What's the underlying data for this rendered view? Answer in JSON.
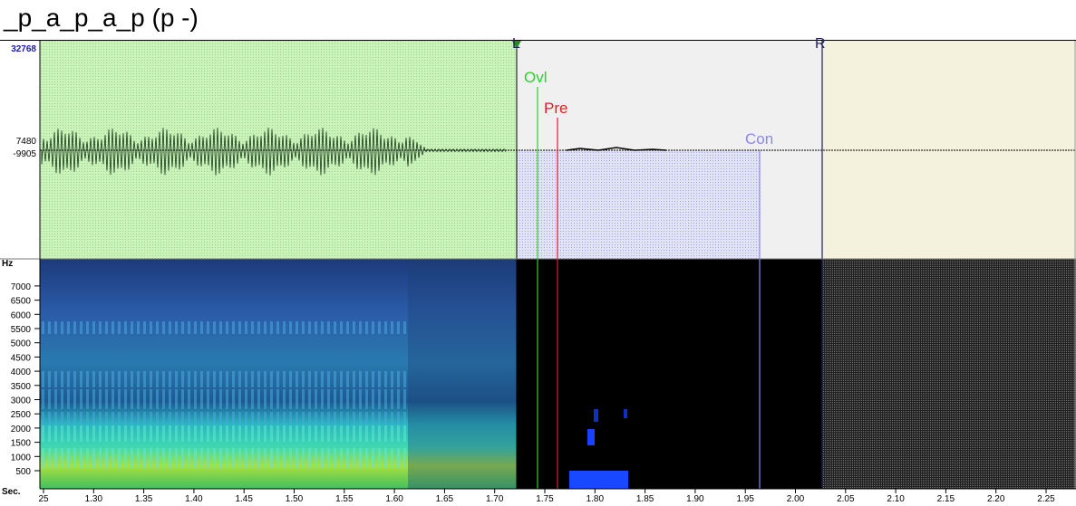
{
  "title": "_p_a_p_a_p (p -)",
  "waveform": {
    "y_max_label": "32768",
    "y_mid_label": "7480",
    "y_mid2_label": "-9905"
  },
  "spectrogram": {
    "unit_label": "Hz",
    "freq_ticks": [
      "7000",
      "6500",
      "6000",
      "5500",
      "5000",
      "4500",
      "4000",
      "3500",
      "3000",
      "2500",
      "2000",
      "1500",
      "1000",
      "500"
    ]
  },
  "time_axis": {
    "unit_label": "Sec.",
    "ticks": [
      "25",
      "1.30",
      "1.35",
      "1.40",
      "1.45",
      "1.50",
      "1.55",
      "1.60",
      "1.65",
      "1.70",
      "1.75",
      "1.80",
      "1.85",
      "1.90",
      "1.95",
      "2.00",
      "2.05",
      "2.10",
      "2.15",
      "2.20",
      "2.25"
    ]
  },
  "markers": {
    "left": {
      "label": "L",
      "color": "#1a6e1a"
    },
    "right": {
      "label": "R",
      "color": "#20205a"
    },
    "ovl": {
      "label": "Ovl",
      "color": "#33cc33"
    },
    "pre": {
      "label": "Pre",
      "color": "#dd2222"
    },
    "con": {
      "label": "Con",
      "color": "#8888ee"
    }
  },
  "colors": {
    "green_region": "#c8f0b8",
    "blue_region": "#d8d8f4",
    "right_region": "#f4f2dc",
    "gray_region": "#f0f0f0"
  }
}
